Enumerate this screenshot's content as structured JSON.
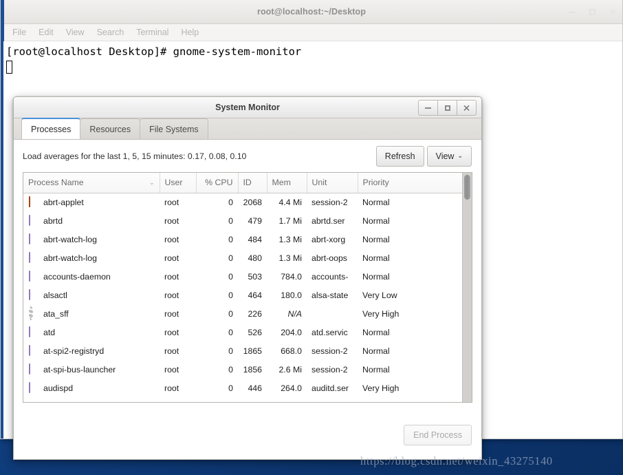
{
  "terminal": {
    "title": "root@localhost:~/Desktop",
    "menu": [
      "File",
      "Edit",
      "View",
      "Search",
      "Terminal",
      "Help"
    ],
    "command_line": "[root@localhost Desktop]# gnome-system-monitor",
    "controls": {
      "minimize": "minimize-icon",
      "maximize": "maximize-icon",
      "close": "close-icon"
    }
  },
  "sysmon": {
    "title": "System Monitor",
    "controls": {
      "minimize": "minimize-icon",
      "maximize": "maximize-icon",
      "close": "close-icon"
    },
    "tabs": [
      {
        "label": "Processes",
        "active": true
      },
      {
        "label": "Resources",
        "active": false
      },
      {
        "label": "File Systems",
        "active": false
      }
    ],
    "load_averages": "Load averages for the last 1, 5, 15 minutes: 0.17, 0.08, 0.10",
    "refresh_label": "Refresh",
    "view_label": "View",
    "view_chevron": "⌄",
    "end_process_label": "End Process",
    "columns": [
      "Process Name",
      "User",
      "% CPU",
      "ID",
      "Mem",
      "Unit",
      "Priority"
    ],
    "sort_chevron": "⌄",
    "rows": [
      {
        "icon": "alert-icon",
        "name": "abrt-applet",
        "user": "root",
        "cpu": "0",
        "id": "2068",
        "mem": "4.4 Mi",
        "unit": "session-2",
        "priority": "Normal"
      },
      {
        "icon": "diamond-icon",
        "name": "abrtd",
        "user": "root",
        "cpu": "0",
        "id": "479",
        "mem": "1.7 Mi",
        "unit": "abrtd.ser",
        "priority": "Normal"
      },
      {
        "icon": "diamond-icon",
        "name": "abrt-watch-log",
        "user": "root",
        "cpu": "0",
        "id": "484",
        "mem": "1.3 Mi",
        "unit": "abrt-xorg",
        "priority": "Normal"
      },
      {
        "icon": "diamond-icon",
        "name": "abrt-watch-log",
        "user": "root",
        "cpu": "0",
        "id": "480",
        "mem": "1.3 Mi",
        "unit": "abrt-oops",
        "priority": "Normal"
      },
      {
        "icon": "diamond-icon",
        "name": "accounts-daemon",
        "user": "root",
        "cpu": "0",
        "id": "503",
        "mem": "784.0",
        "unit": "accounts-",
        "priority": "Normal"
      },
      {
        "icon": "diamond-icon",
        "name": "alsactl",
        "user": "root",
        "cpu": "0",
        "id": "464",
        "mem": "180.0",
        "unit": "alsa-state",
        "priority": "Very Low"
      },
      {
        "icon": "gear-icon",
        "name": "ata_sff",
        "user": "root",
        "cpu": "0",
        "id": "226",
        "mem": "N/A",
        "unit": "",
        "priority": "Very High"
      },
      {
        "icon": "diamond-icon",
        "name": "atd",
        "user": "root",
        "cpu": "0",
        "id": "526",
        "mem": "204.0",
        "unit": "atd.servic",
        "priority": "Normal"
      },
      {
        "icon": "diamond-icon",
        "name": "at-spi2-registryd",
        "user": "root",
        "cpu": "0",
        "id": "1865",
        "mem": "668.0",
        "unit": "session-2",
        "priority": "Normal"
      },
      {
        "icon": "diamond-icon",
        "name": "at-spi-bus-launcher",
        "user": "root",
        "cpu": "0",
        "id": "1856",
        "mem": "2.6 Mi",
        "unit": "session-2",
        "priority": "Normal"
      },
      {
        "icon": "diamond-icon",
        "name": "audispd",
        "user": "root",
        "cpu": "0",
        "id": "446",
        "mem": "264.0",
        "unit": "auditd.ser",
        "priority": "Very High"
      }
    ]
  },
  "watermark": "https://blog.csdn.net/weixin_43275140",
  "colors": {
    "desktop": "#0d3a78",
    "accent_tab": "#4a90d9",
    "terminal_accent": "#1c4e93"
  }
}
